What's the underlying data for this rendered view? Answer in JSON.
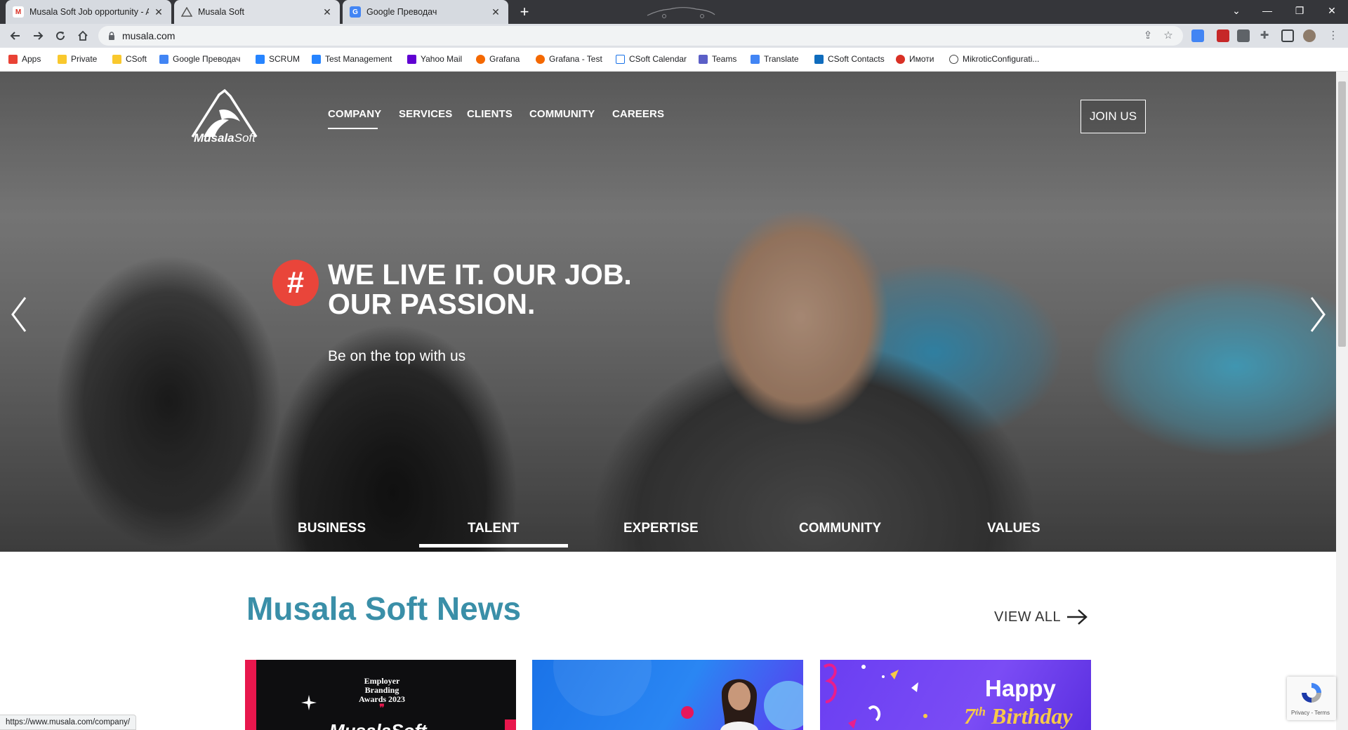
{
  "browser": {
    "tabs": [
      {
        "title": "Musala Soft Job opportunity - Au",
        "favicon": "gmail-icon",
        "active": false
      },
      {
        "title": "Musala Soft",
        "favicon": "musala-icon",
        "active": true
      },
      {
        "title": "Google Преводач",
        "favicon": "google-translate-icon",
        "active": false
      }
    ],
    "new_tab_label": "+",
    "address": "musala.com",
    "bookmarks": [
      {
        "label": "Apps",
        "icon": "apps-grid-icon",
        "color": "#e94235"
      },
      {
        "label": "Private",
        "icon": "folder-icon",
        "color": "#f9c82d"
      },
      {
        "label": "CSoft",
        "icon": "folder-icon",
        "color": "#f9c82d"
      },
      {
        "label": "Google Преводач",
        "icon": "google-translate-icon",
        "color": "#4285f4"
      },
      {
        "label": "SCRUM",
        "icon": "jira-icon",
        "color": "#2684ff"
      },
      {
        "label": "Test Management",
        "icon": "jira-icon",
        "color": "#2684ff"
      },
      {
        "label": "Yahoo Mail",
        "icon": "yahoo-icon",
        "color": "#6001d2"
      },
      {
        "label": "Grafana",
        "icon": "grafana-icon",
        "color": "#f46800"
      },
      {
        "label": "Grafana - Test",
        "icon": "grafana-icon",
        "color": "#f46800"
      },
      {
        "label": "CSoft Calendar",
        "icon": "calendar-icon",
        "color": "#1a73e8"
      },
      {
        "label": "Teams",
        "icon": "teams-icon",
        "color": "#5b5fc7"
      },
      {
        "label": "Translate",
        "icon": "translate-icon",
        "color": "#4285f4"
      },
      {
        "label": "CSoft Contacts",
        "icon": "outlook-icon",
        "color": "#0f6cbd"
      },
      {
        "label": "Имоти",
        "icon": "imoti-icon",
        "color": "#d93025"
      },
      {
        "label": "MikroticConfigurati...",
        "icon": "mikrotik-icon",
        "color": "#444444"
      }
    ],
    "status_url": "https://www.musala.com/company/"
  },
  "site": {
    "logo_word_bold": "Musala",
    "logo_word_light": "Soft",
    "nav": [
      "COMPANY",
      "SERVICES",
      "CLIENTS",
      "COMMUNITY",
      "CAREERS"
    ],
    "active_nav": "COMPANY",
    "join_label": "JOIN US",
    "hero": {
      "badge": "#",
      "headline_line1": "WE LIVE IT. OUR JOB.",
      "headline_line2": "OUR PASSION.",
      "subline": "Be on the top with us"
    },
    "slider_tabs": [
      "BUSINESS",
      "TALENT",
      "EXPERTISE",
      "COMMUNITY",
      "VALUES"
    ],
    "active_slider_tab": "TALENT",
    "news": {
      "title": "Musala Soft News",
      "view_all": "VIEW ALL",
      "cards": [
        {
          "line1": "Employer",
          "line2": "Branding",
          "line3": "Awards 2023",
          "brand": "MusalaSoft"
        },
        {},
        {
          "happy": "Happy",
          "num": "7",
          "sup": "th",
          "word": "Birthday"
        }
      ]
    },
    "recaptcha": "Privacy - Terms"
  },
  "colors": {
    "accent_red": "#e9453a",
    "news_title": "#3a8fa8",
    "chrome_dark": "#35363a"
  }
}
